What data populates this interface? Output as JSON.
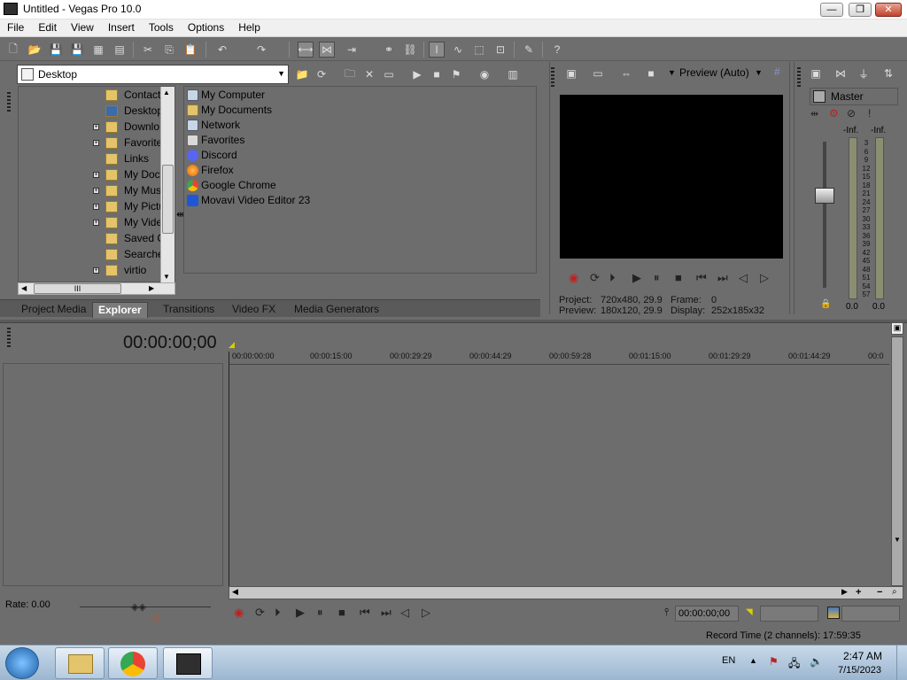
{
  "window": {
    "title": "Untitled - Vegas Pro 10.0",
    "btn_minimize": "—",
    "btn_restore": "❐",
    "btn_close": "✕"
  },
  "menu": [
    "File",
    "Edit",
    "View",
    "Insert",
    "Tools",
    "Options",
    "Help"
  ],
  "explorer": {
    "location": "Desktop",
    "tree": [
      {
        "label": "Contact",
        "expandable": false
      },
      {
        "label": "Desktop",
        "expandable": false
      },
      {
        "label": "Downlo",
        "expandable": true
      },
      {
        "label": "Favorite",
        "expandable": true
      },
      {
        "label": "Links",
        "expandable": false
      },
      {
        "label": "My Doc",
        "expandable": true
      },
      {
        "label": "My Mus",
        "expandable": true
      },
      {
        "label": "My Pictu",
        "expandable": true
      },
      {
        "label": "My Vide",
        "expandable": true
      },
      {
        "label": "Saved G",
        "expandable": false
      },
      {
        "label": "Searche",
        "expandable": false
      },
      {
        "label": "virtio",
        "expandable": true
      }
    ],
    "files": [
      {
        "label": "My Computer",
        "icon": "computer-icon",
        "color": "#c7d6e6"
      },
      {
        "label": "My Documents",
        "icon": "folder-icon",
        "color": "#e4c46b"
      },
      {
        "label": "Network",
        "icon": "network-icon",
        "color": "#c7d6e6"
      },
      {
        "label": "Favorites",
        "icon": "favorites-icon",
        "color": "#d9d9d9"
      },
      {
        "label": "Discord",
        "icon": "discord-icon",
        "color": "#5865f2"
      },
      {
        "label": "Firefox",
        "icon": "firefox-icon",
        "color": "#e66000"
      },
      {
        "label": "Google Chrome",
        "icon": "chrome-icon",
        "color": "#34a853"
      },
      {
        "label": "Movavi Video Editor 23",
        "icon": "movavi-icon",
        "color": "#1e57d6"
      }
    ],
    "hscroll_thumb": "III"
  },
  "tabs": [
    "Project Media",
    "Explorer",
    "Transitions",
    "Video FX",
    "Media Generators"
  ],
  "active_tab": "Explorer",
  "preview": {
    "mode": "Preview (Auto)",
    "project_label": "Project:",
    "project_value": "720x480, 29.9",
    "frame_label": "Frame:",
    "frame_value": "0",
    "preview_label": "Preview:",
    "preview_value": "180x120, 29.9",
    "display_label": "Display:",
    "display_value": "252x185x32"
  },
  "mixer": {
    "title": "Master",
    "inf_left": "-Inf.",
    "inf_right": "-Inf.",
    "scale": [
      "3",
      "6",
      "9",
      "12",
      "15",
      "18",
      "21",
      "24",
      "27",
      "30",
      "33",
      "36",
      "39",
      "42",
      "45",
      "48",
      "51",
      "54",
      "57"
    ],
    "val_left": "0.0",
    "val_right": "0.0"
  },
  "timeline": {
    "timecode": "00:00:00;00",
    "ruler": [
      "00:00:00:00",
      "00:00:15:00",
      "00:00:29:29",
      "00:00:44:29",
      "00:00:59:28",
      "00:01:15:00",
      "00:01:29:29",
      "00:01:44:29",
      "00:0"
    ],
    "rate": "Rate: 0.00",
    "cursor_time": "00:00:00;00",
    "record_time": "Record Time (2 channels): 17:59:35"
  },
  "taskbar": {
    "lang": "EN",
    "time": "2:47 AM",
    "date": "7/15/2023"
  },
  "colors": {
    "panel": "#6d6d6d",
    "taskbar": "#b7cbe0",
    "accent": "#c02020"
  }
}
